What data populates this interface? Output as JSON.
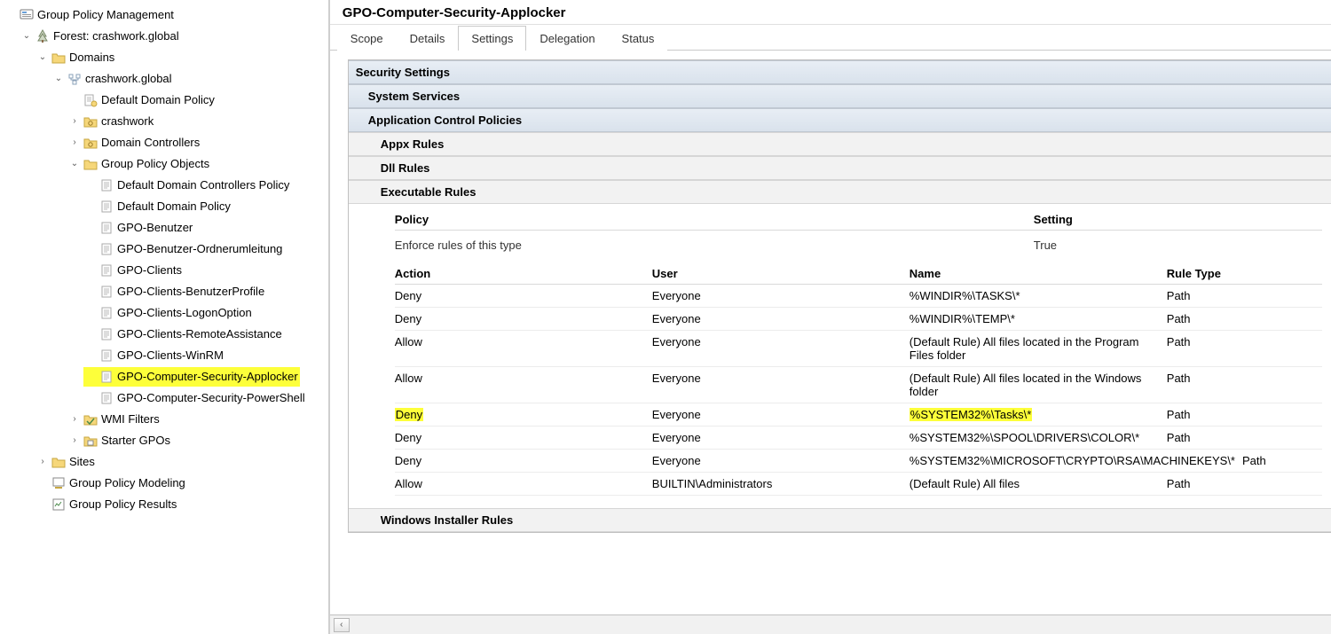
{
  "tree": {
    "root": "Group Policy Management",
    "forest": "Forest: crashwork.global",
    "domains": "Domains",
    "domain_name": "crashwork.global",
    "default_domain_policy": "Default Domain Policy",
    "ou_crashwork": "crashwork",
    "ou_domain_controllers": "Domain Controllers",
    "gpo_container": "Group Policy Objects",
    "gpos": {
      "ddcp": "Default Domain Controllers Policy",
      "ddp": "Default Domain Policy",
      "benutzer": "GPO-Benutzer",
      "benutzer_ou": "GPO-Benutzer-Ordnerumleitung",
      "clients": "GPO-Clients",
      "clients_bp": "GPO-Clients-BenutzerProfile",
      "clients_lo": "GPO-Clients-LogonOption",
      "clients_ra": "GPO-Clients-RemoteAssistance",
      "clients_wrm": "GPO-Clients-WinRM",
      "sec_applocker": "GPO-Computer-Security-Applocker",
      "sec_ps": "GPO-Computer-Security-PowerShell"
    },
    "wmi_filters": "WMI Filters",
    "starter_gpos": "Starter GPOs",
    "sites": "Sites",
    "gpm_modeling": "Group Policy Modeling",
    "gpm_results": "Group Policy Results"
  },
  "main": {
    "title": "GPO-Computer-Security-Applocker",
    "tabs": {
      "scope": "Scope",
      "details": "Details",
      "settings": "Settings",
      "delegation": "Delegation",
      "status": "Status"
    },
    "sections": {
      "security_settings": "Security Settings",
      "system_services": "System Services",
      "app_control": "Application Control Policies",
      "appx_rules": "Appx Rules",
      "dll_rules": "Dll Rules",
      "exe_rules": "Executable Rules",
      "win_installer": "Windows Installer Rules"
    },
    "kv": {
      "policy_label": "Policy",
      "setting_label": "Setting",
      "enforce_label": "Enforce rules of this type",
      "enforce_value": "True"
    },
    "headers": {
      "action": "Action",
      "user": "User",
      "name": "Name",
      "rule_type": "Rule Type"
    },
    "rules": [
      {
        "action": "Deny",
        "user": "Everyone",
        "name": "%WINDIR%\\TASKS\\*",
        "type": "Path",
        "hl": false
      },
      {
        "action": "Deny",
        "user": "Everyone",
        "name": "%WINDIR%\\TEMP\\*",
        "type": "Path",
        "hl": false
      },
      {
        "action": "Allow",
        "user": "Everyone",
        "name": "(Default Rule) All files located in the Program Files folder",
        "type": "Path",
        "hl": false
      },
      {
        "action": "Allow",
        "user": "Everyone",
        "name": "(Default Rule) All files located in the Windows folder",
        "type": "Path",
        "hl": false
      },
      {
        "action": "Deny",
        "user": "Everyone",
        "name": "%SYSTEM32%\\Tasks\\*",
        "type": "Path",
        "hl": true
      },
      {
        "action": "Deny",
        "user": "Everyone",
        "name": "%SYSTEM32%\\SPOOL\\DRIVERS\\COLOR\\*",
        "type": "Path",
        "hl": false
      },
      {
        "action": "Deny",
        "user": "Everyone",
        "name": "%SYSTEM32%\\MICROSOFT\\CRYPTO\\RSA\\MACHINEKEYS\\*",
        "type": "Path",
        "hl": false
      },
      {
        "action": "Allow",
        "user": "BUILTIN\\Administrators",
        "name": "(Default Rule) All files",
        "type": "Path",
        "hl": false
      }
    ]
  }
}
